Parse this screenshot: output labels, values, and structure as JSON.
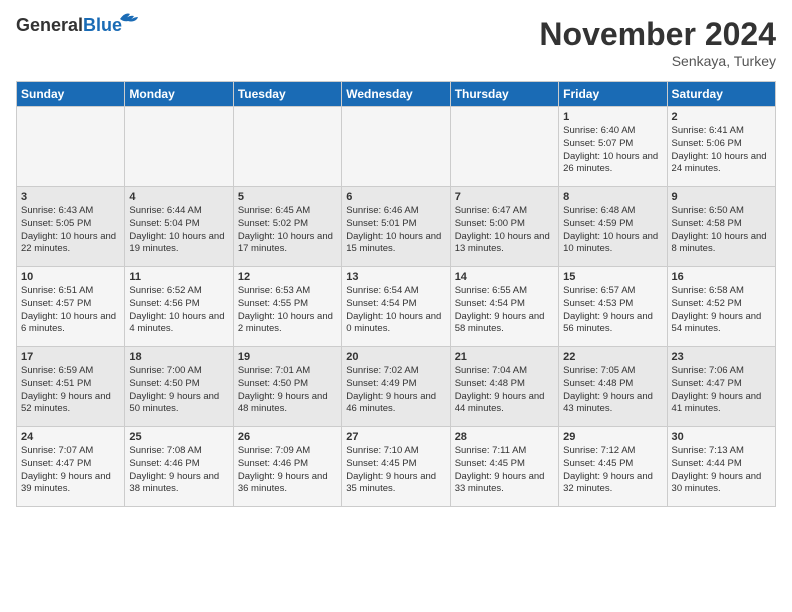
{
  "header": {
    "logo_line1": "General",
    "logo_line2": "Blue",
    "month_year": "November 2024",
    "location": "Senkaya, Turkey"
  },
  "days_of_week": [
    "Sunday",
    "Monday",
    "Tuesday",
    "Wednesday",
    "Thursday",
    "Friday",
    "Saturday"
  ],
  "weeks": [
    [
      {
        "num": "",
        "info": ""
      },
      {
        "num": "",
        "info": ""
      },
      {
        "num": "",
        "info": ""
      },
      {
        "num": "",
        "info": ""
      },
      {
        "num": "",
        "info": ""
      },
      {
        "num": "1",
        "info": "Sunrise: 6:40 AM\nSunset: 5:07 PM\nDaylight: 10 hours and 26 minutes."
      },
      {
        "num": "2",
        "info": "Sunrise: 6:41 AM\nSunset: 5:06 PM\nDaylight: 10 hours and 24 minutes."
      }
    ],
    [
      {
        "num": "3",
        "info": "Sunrise: 6:43 AM\nSunset: 5:05 PM\nDaylight: 10 hours and 22 minutes."
      },
      {
        "num": "4",
        "info": "Sunrise: 6:44 AM\nSunset: 5:04 PM\nDaylight: 10 hours and 19 minutes."
      },
      {
        "num": "5",
        "info": "Sunrise: 6:45 AM\nSunset: 5:02 PM\nDaylight: 10 hours and 17 minutes."
      },
      {
        "num": "6",
        "info": "Sunrise: 6:46 AM\nSunset: 5:01 PM\nDaylight: 10 hours and 15 minutes."
      },
      {
        "num": "7",
        "info": "Sunrise: 6:47 AM\nSunset: 5:00 PM\nDaylight: 10 hours and 13 minutes."
      },
      {
        "num": "8",
        "info": "Sunrise: 6:48 AM\nSunset: 4:59 PM\nDaylight: 10 hours and 10 minutes."
      },
      {
        "num": "9",
        "info": "Sunrise: 6:50 AM\nSunset: 4:58 PM\nDaylight: 10 hours and 8 minutes."
      }
    ],
    [
      {
        "num": "10",
        "info": "Sunrise: 6:51 AM\nSunset: 4:57 PM\nDaylight: 10 hours and 6 minutes."
      },
      {
        "num": "11",
        "info": "Sunrise: 6:52 AM\nSunset: 4:56 PM\nDaylight: 10 hours and 4 minutes."
      },
      {
        "num": "12",
        "info": "Sunrise: 6:53 AM\nSunset: 4:55 PM\nDaylight: 10 hours and 2 minutes."
      },
      {
        "num": "13",
        "info": "Sunrise: 6:54 AM\nSunset: 4:54 PM\nDaylight: 10 hours and 0 minutes."
      },
      {
        "num": "14",
        "info": "Sunrise: 6:55 AM\nSunset: 4:54 PM\nDaylight: 9 hours and 58 minutes."
      },
      {
        "num": "15",
        "info": "Sunrise: 6:57 AM\nSunset: 4:53 PM\nDaylight: 9 hours and 56 minutes."
      },
      {
        "num": "16",
        "info": "Sunrise: 6:58 AM\nSunset: 4:52 PM\nDaylight: 9 hours and 54 minutes."
      }
    ],
    [
      {
        "num": "17",
        "info": "Sunrise: 6:59 AM\nSunset: 4:51 PM\nDaylight: 9 hours and 52 minutes."
      },
      {
        "num": "18",
        "info": "Sunrise: 7:00 AM\nSunset: 4:50 PM\nDaylight: 9 hours and 50 minutes."
      },
      {
        "num": "19",
        "info": "Sunrise: 7:01 AM\nSunset: 4:50 PM\nDaylight: 9 hours and 48 minutes."
      },
      {
        "num": "20",
        "info": "Sunrise: 7:02 AM\nSunset: 4:49 PM\nDaylight: 9 hours and 46 minutes."
      },
      {
        "num": "21",
        "info": "Sunrise: 7:04 AM\nSunset: 4:48 PM\nDaylight: 9 hours and 44 minutes."
      },
      {
        "num": "22",
        "info": "Sunrise: 7:05 AM\nSunset: 4:48 PM\nDaylight: 9 hours and 43 minutes."
      },
      {
        "num": "23",
        "info": "Sunrise: 7:06 AM\nSunset: 4:47 PM\nDaylight: 9 hours and 41 minutes."
      }
    ],
    [
      {
        "num": "24",
        "info": "Sunrise: 7:07 AM\nSunset: 4:47 PM\nDaylight: 9 hours and 39 minutes."
      },
      {
        "num": "25",
        "info": "Sunrise: 7:08 AM\nSunset: 4:46 PM\nDaylight: 9 hours and 38 minutes."
      },
      {
        "num": "26",
        "info": "Sunrise: 7:09 AM\nSunset: 4:46 PM\nDaylight: 9 hours and 36 minutes."
      },
      {
        "num": "27",
        "info": "Sunrise: 7:10 AM\nSunset: 4:45 PM\nDaylight: 9 hours and 35 minutes."
      },
      {
        "num": "28",
        "info": "Sunrise: 7:11 AM\nSunset: 4:45 PM\nDaylight: 9 hours and 33 minutes."
      },
      {
        "num": "29",
        "info": "Sunrise: 7:12 AM\nSunset: 4:45 PM\nDaylight: 9 hours and 32 minutes."
      },
      {
        "num": "30",
        "info": "Sunrise: 7:13 AM\nSunset: 4:44 PM\nDaylight: 9 hours and 30 minutes."
      }
    ]
  ]
}
